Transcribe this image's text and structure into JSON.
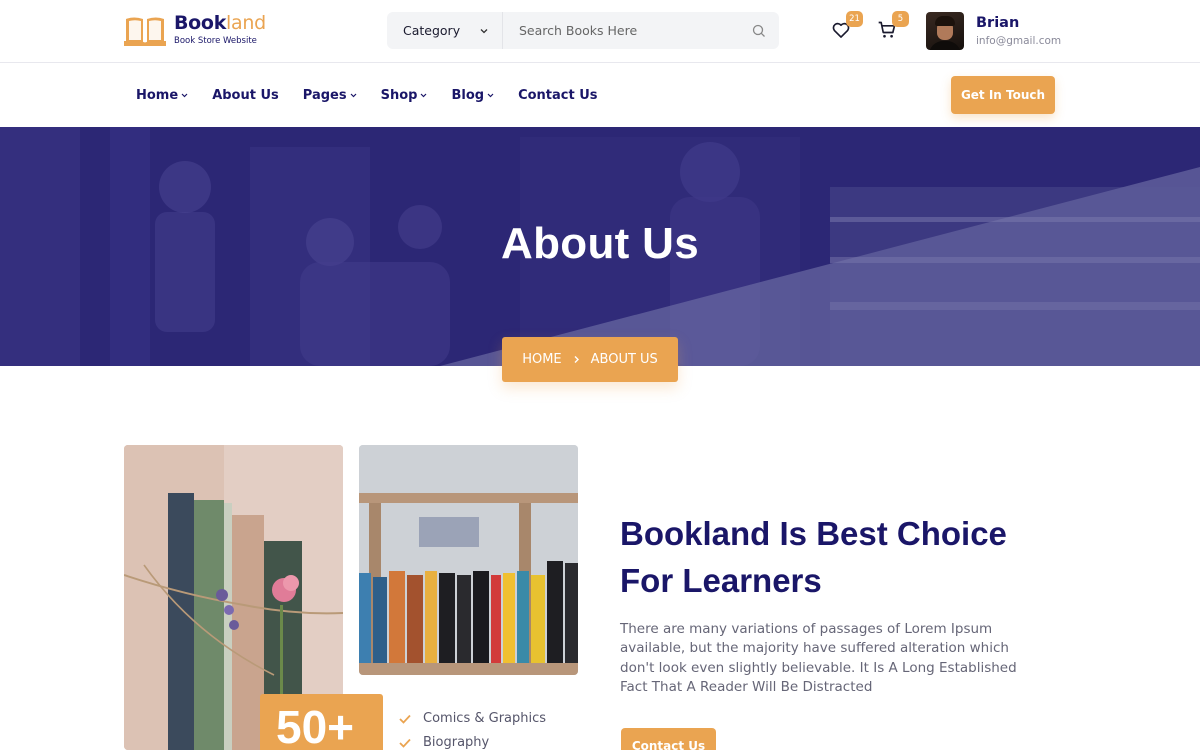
{
  "brand": {
    "name_part1": "Book",
    "name_part2": "land",
    "tagline": "Book Store Website",
    "accent_color": "#eaa451",
    "primary_color": "#1a1668"
  },
  "search": {
    "category_label": "Category",
    "placeholder": "Search Books Here"
  },
  "header": {
    "wishlist_count": "21",
    "cart_count": "5",
    "user_name": "Brian",
    "user_email": "info@gmail.com"
  },
  "nav": {
    "items": [
      {
        "label": "Home",
        "has_dropdown": true
      },
      {
        "label": "About Us",
        "has_dropdown": false
      },
      {
        "label": "Pages",
        "has_dropdown": true
      },
      {
        "label": "Shop",
        "has_dropdown": true
      },
      {
        "label": "Blog",
        "has_dropdown": true
      },
      {
        "label": "Contact Us",
        "has_dropdown": false
      }
    ],
    "cta_label": "Get In Touch"
  },
  "hero": {
    "title": "About Us",
    "breadcrumb_home": "HOME",
    "breadcrumb_current": "ABOUT US"
  },
  "about": {
    "stat_number": "50+",
    "features": [
      "Comics & Graphics",
      "Biography"
    ],
    "heading_line1": "Bookland Is Best Choice",
    "heading_line2": "For Learners",
    "paragraph": "There are many variations of passages of Lorem Ipsum available, but the majority have suffered alteration which don't look even slightly believable. It Is A Long Established Fact That A Reader Will Be Distracted",
    "button_label": "Contact Us"
  },
  "icons": [
    "book-logo-icon",
    "chevron-down-icon",
    "search-icon",
    "heart-icon",
    "cart-icon",
    "chevron-right-icon",
    "check-icon"
  ]
}
